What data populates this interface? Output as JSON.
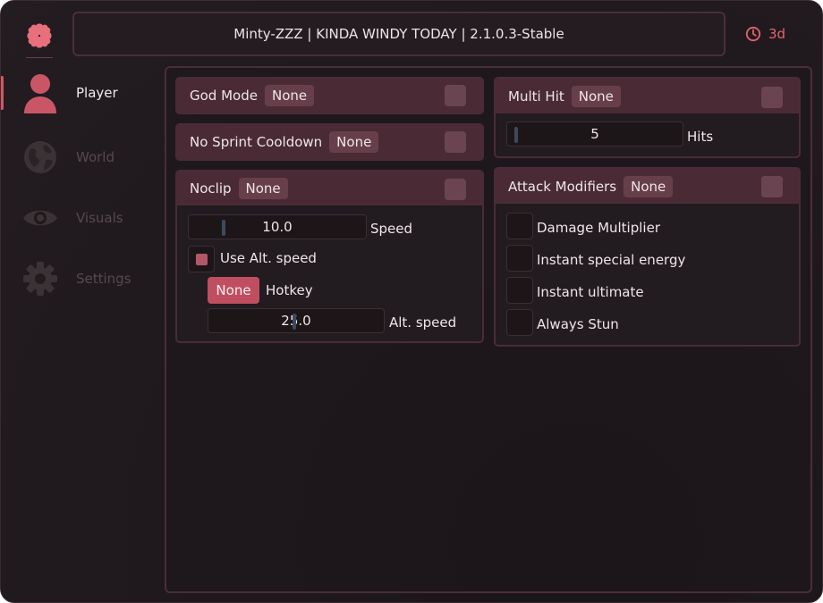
{
  "app": {
    "title": "Minty-ZZZ | KINDA WINDY TODAY | 2.1.0.3-Stable",
    "timer": "3d",
    "accent": "#d45664"
  },
  "sidebar": {
    "items": [
      {
        "label": "Player",
        "icon": "person-icon",
        "active": true
      },
      {
        "label": "World",
        "icon": "globe-icon",
        "active": false
      },
      {
        "label": "Visuals",
        "icon": "eye-icon",
        "active": false
      },
      {
        "label": "Settings",
        "icon": "gear-icon",
        "active": false
      }
    ]
  },
  "cards": {
    "god_mode": {
      "title": "God Mode",
      "hotkey": "None",
      "enabled": false
    },
    "no_sprint": {
      "title": "No Sprint Cooldown",
      "hotkey": "None",
      "enabled": false
    },
    "noclip": {
      "title": "Noclip",
      "hotkey": "None",
      "enabled": false,
      "speed": {
        "value": "10.0",
        "label": "Speed"
      },
      "use_alt": {
        "label": "Use Alt. speed",
        "checked": true
      },
      "hotkey_row": {
        "button": "None",
        "label": "Hotkey"
      },
      "alt_speed": {
        "value": "25.0",
        "label": "Alt. speed"
      }
    },
    "multi_hit": {
      "title": "Multi Hit",
      "hotkey": "None",
      "enabled": false,
      "hits": {
        "value": "5",
        "label": "Hits"
      }
    },
    "attack_modifiers": {
      "title": "Attack Modifiers",
      "hotkey": "None",
      "enabled": false,
      "options": [
        {
          "label": "Damage Multiplier",
          "checked": false
        },
        {
          "label": "Instant special energy",
          "checked": false
        },
        {
          "label": "Instant ultimate",
          "checked": false
        },
        {
          "label": "Always Stun",
          "checked": false
        }
      ]
    }
  }
}
